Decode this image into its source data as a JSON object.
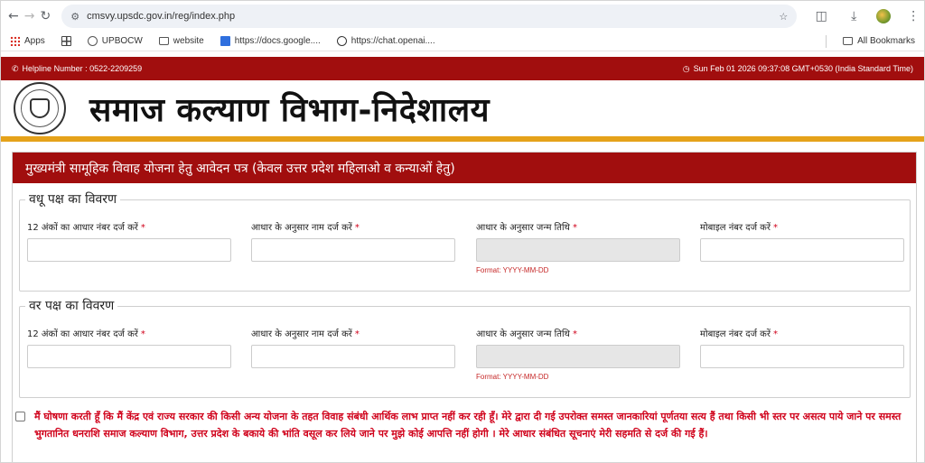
{
  "browser": {
    "url": "cmsvy.upsdc.gov.in/reg/index.php",
    "bookmarks": [
      {
        "label": "Apps",
        "icon": "apps-icon"
      },
      {
        "label": "",
        "icon": "grid-icon"
      },
      {
        "label": "UPBOCW",
        "icon": "globe-icon"
      },
      {
        "label": "website",
        "icon": "folder-icon"
      },
      {
        "label": "https://docs.google....",
        "icon": "docs-icon"
      },
      {
        "label": "https://chat.openai....",
        "icon": "chatgpt-icon"
      }
    ],
    "all_bookmarks": "All Bookmarks"
  },
  "topbar": {
    "helpline": "Helpline Number : 0522-2209259",
    "datetime": "Sun Feb 01 2026 09:37:08 GMT+0530 (India Standard Time)"
  },
  "header": {
    "title": "समाज कल्याण विभाग-निदेशालय"
  },
  "form": {
    "heading": "मुख्यमंत्री सामूहिक विवाह योजना हेतु आवेदन पत्र (केवल उत्तर प्रदेश महिलाओ व कन्याओं हेतु)",
    "bride": {
      "legend": "वधू पक्ष का विवरण",
      "aadhaar_label": "12 अंकों का आधार नंबर दर्ज करें",
      "name_label": "आधार के अनुसार नाम दर्ज करें",
      "dob_label": "आधार के अनुसार जन्म तिथि",
      "dob_hint": "Format: YYYY-MM-DD",
      "mobile_label": "मोबाइल नंबर दर्ज करें",
      "required_mark": "*"
    },
    "groom": {
      "legend": "वर पक्ष का विवरण",
      "aadhaar_label": "12 अंकों का आधार नंबर दर्ज करें",
      "name_label": "आधार के अनुसार नाम दर्ज करें",
      "dob_label": "आधार के अनुसार जन्म तिथि",
      "dob_hint": "Format: YYYY-MM-DD",
      "mobile_label": "मोबाइल नंबर दर्ज करें",
      "required_mark": "*"
    },
    "declaration": "मैं घोषणा करती हूँ कि मैं केंद्र एवं राज्य सरकार की किसी अन्य योजना के तहत विवाह संबंधी आर्थिक लाभ प्राप्त नहीं कर रही हूँ। मेरे द्वारा दी गई उपरोक्त समस्त जानकारियां पूर्णतया सत्य हैं तथा किसी भी स्तर पर असत्य पाये जाने पर समस्त भुगतानित धनराशि समाज कल्याण विभाग, उत्तर प्रदेश के बकाये की भांति वसूल कर लिये जाने पर मुझे कोई आपत्ति नहीं होगी । मेरे आधार संबंधित सूचनाएं मेरी सहमति से दर्ज की गई हैं।"
  }
}
